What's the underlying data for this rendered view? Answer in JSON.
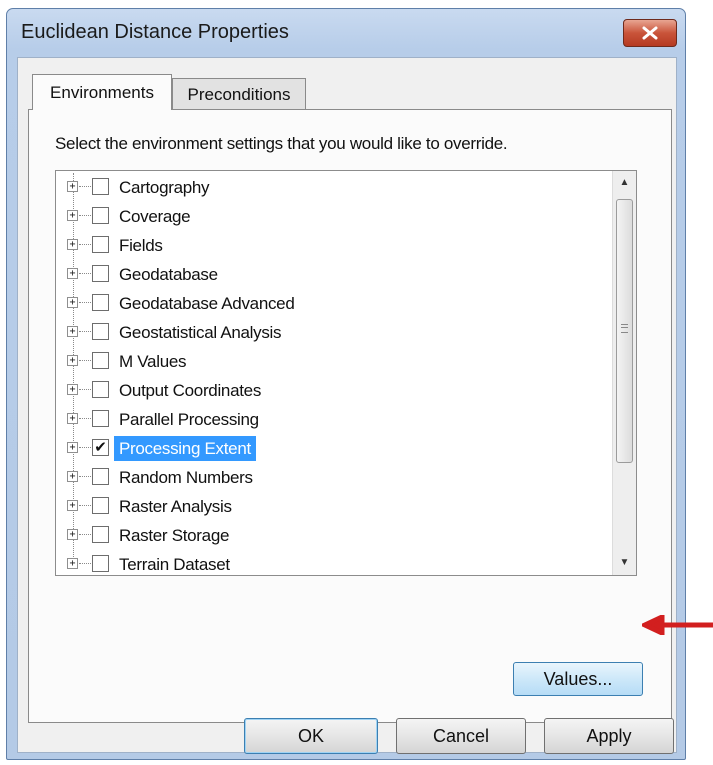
{
  "window": {
    "title": "Euclidean Distance Properties",
    "close_icon": "close-icon"
  },
  "tabs": [
    {
      "label": "Environments",
      "active": true
    },
    {
      "label": "Preconditions",
      "active": false
    }
  ],
  "instruction": "Select the environment settings that you would like to override.",
  "tree": {
    "items": [
      {
        "label": "Cartography",
        "checked": false,
        "selected": false
      },
      {
        "label": "Coverage",
        "checked": false,
        "selected": false
      },
      {
        "label": "Fields",
        "checked": false,
        "selected": false
      },
      {
        "label": "Geodatabase",
        "checked": false,
        "selected": false
      },
      {
        "label": "Geodatabase Advanced",
        "checked": false,
        "selected": false
      },
      {
        "label": "Geostatistical Analysis",
        "checked": false,
        "selected": false
      },
      {
        "label": "M Values",
        "checked": false,
        "selected": false
      },
      {
        "label": "Output Coordinates",
        "checked": false,
        "selected": false
      },
      {
        "label": "Parallel Processing",
        "checked": false,
        "selected": false
      },
      {
        "label": "Processing Extent",
        "checked": true,
        "selected": true
      },
      {
        "label": "Random Numbers",
        "checked": false,
        "selected": false
      },
      {
        "label": "Raster Analysis",
        "checked": false,
        "selected": false
      },
      {
        "label": "Raster Storage",
        "checked": false,
        "selected": false
      },
      {
        "label": "Terrain Dataset",
        "checked": false,
        "selected": false
      }
    ]
  },
  "buttons": {
    "values": "Values...",
    "ok": "OK",
    "cancel": "Cancel",
    "apply": "Apply"
  },
  "annotation": {
    "arrow_color": "#d21f1f"
  },
  "colors": {
    "selection": "#3399ff",
    "close_button": "#c9543a"
  }
}
